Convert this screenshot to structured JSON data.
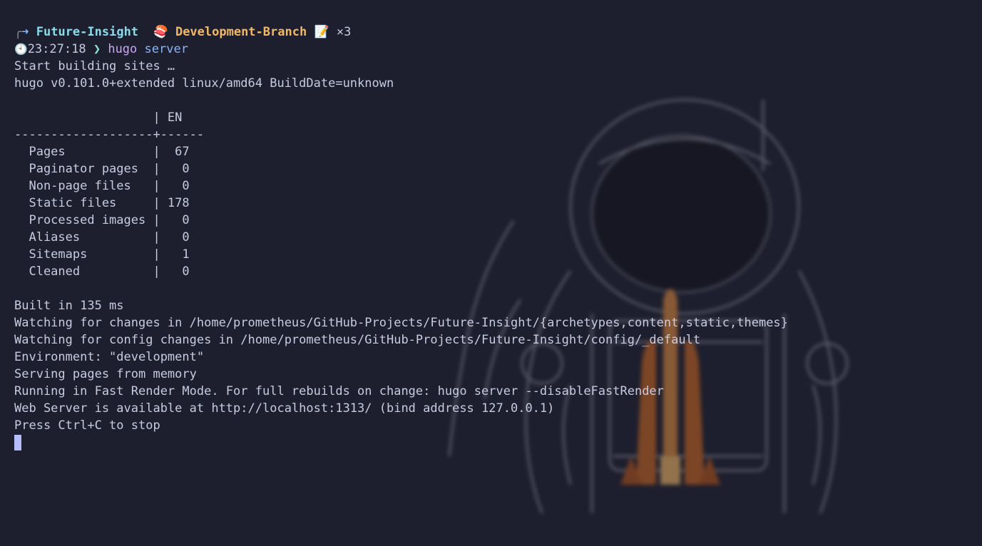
{
  "prompt": {
    "corner": "╭",
    "arrow": "➜",
    "repo": "Future-Insight",
    "branch_icon": "🍣",
    "branch": "Development-Branch",
    "status_icon": "📝",
    "status_count": "×3",
    "clock_icon": "🕙",
    "time": "23:27:18",
    "chevron": "❯",
    "command": "hugo",
    "argument": "server"
  },
  "output": {
    "start": "Start building sites …",
    "version": "hugo v0.101.0+extended linux/amd64 BuildDate=unknown",
    "table_header": "                   | EN",
    "table_rule": "-------------------+------",
    "table_rows": [
      "  Pages            |  67",
      "  Paginator pages  |   0",
      "  Non-page files   |   0",
      "  Static files     | 178",
      "  Processed images |   0",
      "  Aliases          |   0",
      "  Sitemaps         |   1",
      "  Cleaned          |   0"
    ],
    "messages": [
      "Built in 135 ms",
      "Watching for changes in /home/prometheus/GitHub-Projects/Future-Insight/{archetypes,content,static,themes}",
      "Watching for config changes in /home/prometheus/GitHub-Projects/Future-Insight/config/_default",
      "Environment: \"development\"",
      "Serving pages from memory",
      "Running in Fast Render Mode. For full rebuilds on change: hugo server --disableFastRender",
      "Web Server is available at http://localhost:1313/ (bind address 127.0.0.1)",
      "Press Ctrl+C to stop"
    ]
  },
  "colors": {
    "background": "#1e1f2e",
    "foreground": "#c7cbe2",
    "repo": "#89dceb",
    "branch": "#f2b866",
    "command": "#cba6f7",
    "argument": "#89b4fa",
    "cursor": "#b4befe"
  }
}
